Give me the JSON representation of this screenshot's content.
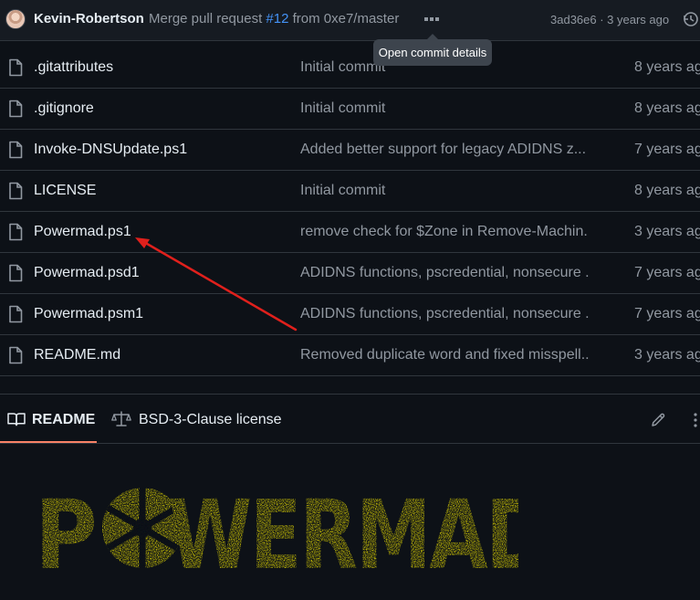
{
  "commit": {
    "author": "Kevin-Robertson",
    "message_prefix": "Merge pull request ",
    "pr_link": "#12",
    "message_suffix": " from 0xe7/master",
    "sha_age": "3ad36e6 · 3 years ago",
    "tooltip": "Open commit details"
  },
  "files": [
    {
      "name": ".gitattributes",
      "message": "Initial commit",
      "age": "8 years ag"
    },
    {
      "name": ".gitignore",
      "message": "Initial commit",
      "age": "8 years ag"
    },
    {
      "name": "Invoke-DNSUpdate.ps1",
      "message": "Added better support for legacy ADIDNS z...",
      "age": "7 years ag"
    },
    {
      "name": "LICENSE",
      "message": "Initial commit",
      "age": "8 years ag"
    },
    {
      "name": "Powermad.ps1",
      "message": "remove check for $Zone in Remove-Machin...",
      "age": "3 years ag"
    },
    {
      "name": "Powermad.psd1",
      "message": "ADIDNS functions, pscredential, nonsecure ...",
      "age": "7 years ag"
    },
    {
      "name": "Powermad.psm1",
      "message": "ADIDNS functions, pscredential, nonsecure ...",
      "age": "7 years ag"
    },
    {
      "name": "README.md",
      "message": "Removed duplicate word and fixed misspell...",
      "age": "3 years ag"
    }
  ],
  "tabs": {
    "readme": "README",
    "license": "BSD-3-Clause license"
  },
  "logo": {
    "text": "POWERMAD",
    "color": "#f2e600"
  },
  "annotation": {
    "arrow_color": "#e0201c"
  }
}
